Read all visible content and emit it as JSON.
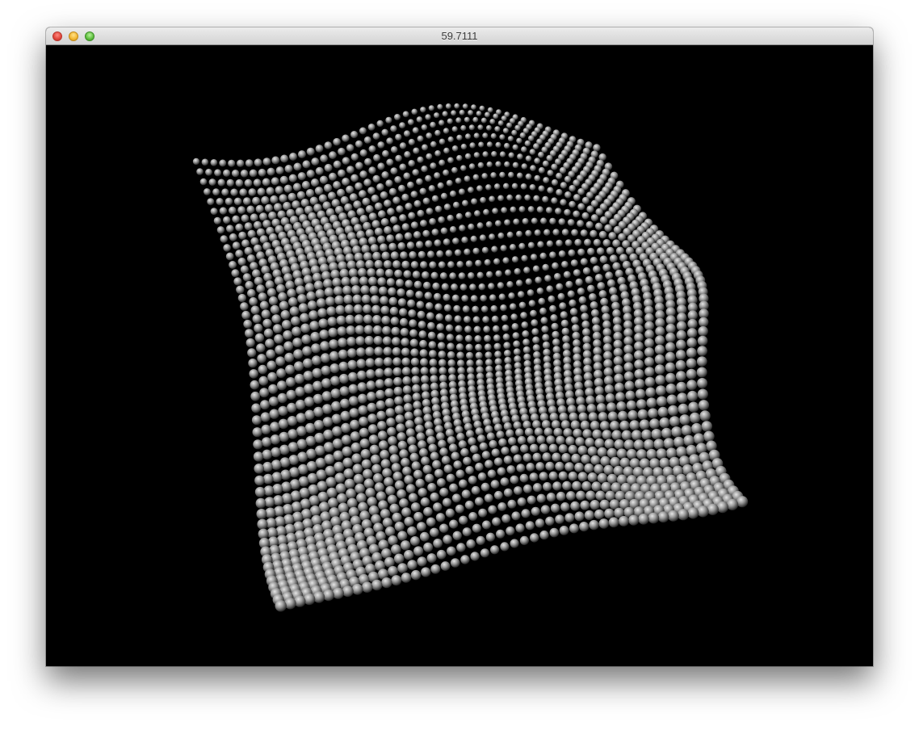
{
  "window": {
    "title": "59.7111"
  },
  "colors": {
    "background": "#000000",
    "sphere_highlight": "#e6e6e6",
    "sphere_mid": "#9a9a9a",
    "sphere_dark": "#1e1e1e"
  },
  "scene": {
    "content": "sphere-grid-surface",
    "grid_cols": 48,
    "grid_rows": 48
  }
}
